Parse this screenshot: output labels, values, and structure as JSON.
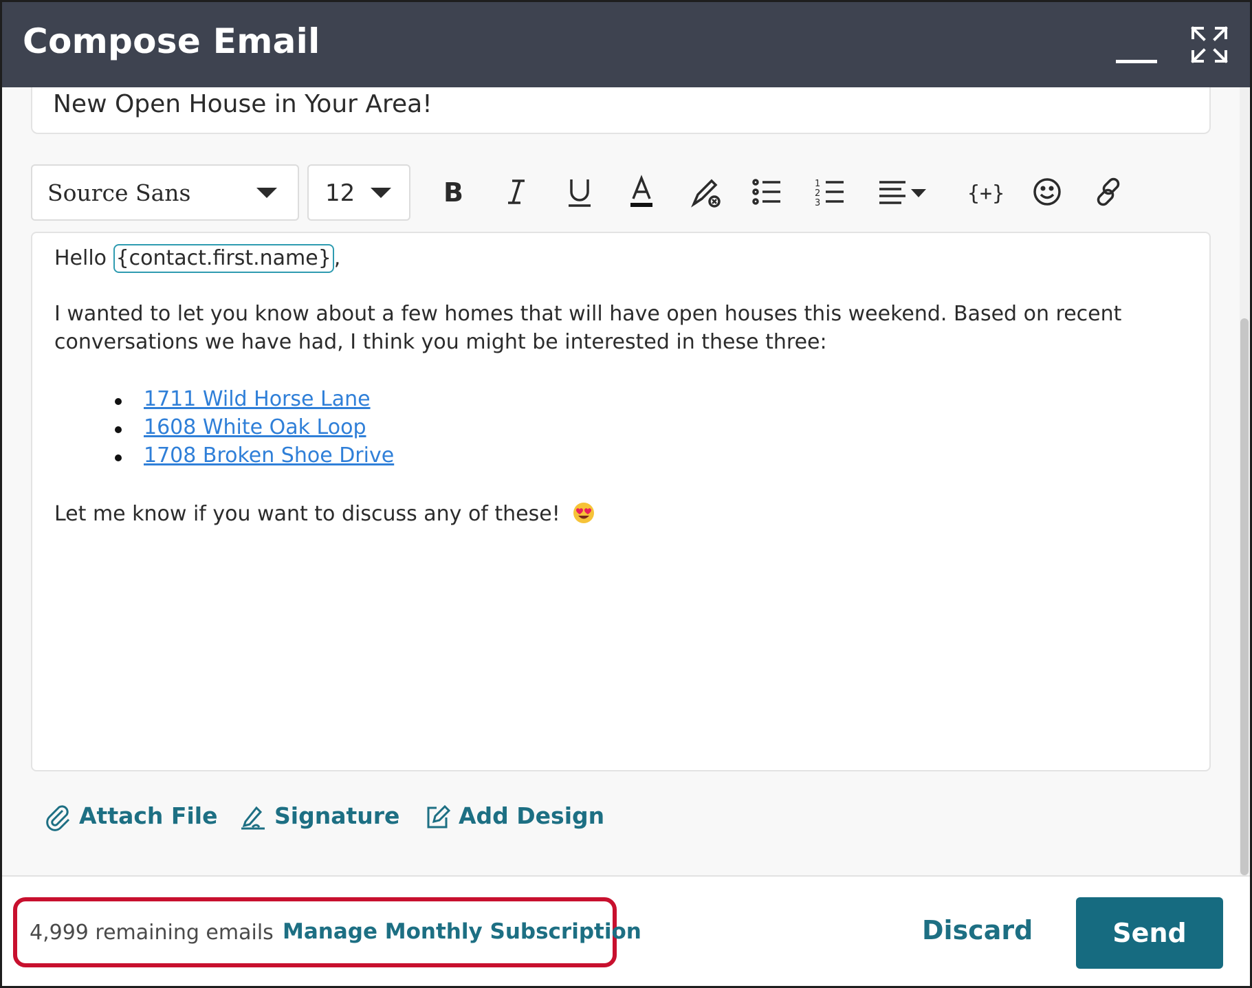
{
  "window": {
    "title": "Compose Email"
  },
  "subject": {
    "value": "New Open House in Your Area!"
  },
  "toolbar": {
    "font_family": "Source Sans",
    "font_size": "12",
    "icons": [
      "bold-icon",
      "italic-icon",
      "underline-icon",
      "font-color-icon",
      "clear-format-icon",
      "bullet-list-icon",
      "numbered-list-icon",
      "align-icon",
      "merge-field-icon",
      "emoji-icon",
      "link-icon"
    ]
  },
  "body": {
    "greeting": "Hello ",
    "token": "{contact.first.name}",
    "greeting_suffix": ",",
    "para1_line1": "I wanted to let you know about a few homes that will have open houses this weekend. Based on recent",
    "para1_line2": "conversations we have had, I think you might be interested in these three:",
    "links": [
      "1711 Wild Horse Lane",
      "1608 White Oak Loop",
      "1708 Broken Shoe Drive"
    ],
    "closing": "Let me know if you want to discuss any of these!",
    "closing_emoji": "heart-eyes-emoji"
  },
  "actions": {
    "attach": "Attach File",
    "signature": "Signature",
    "design": "Add Design"
  },
  "footer": {
    "remaining": "4,999 remaining emails",
    "manage": "Manage Monthly Subscription",
    "discard": "Discard",
    "send": "Send"
  },
  "colors": {
    "header": "#3e4350",
    "accent": "#1d6f83",
    "send_bg": "#166b80",
    "link": "#2f7fd8",
    "highlight": "#c8102e"
  }
}
